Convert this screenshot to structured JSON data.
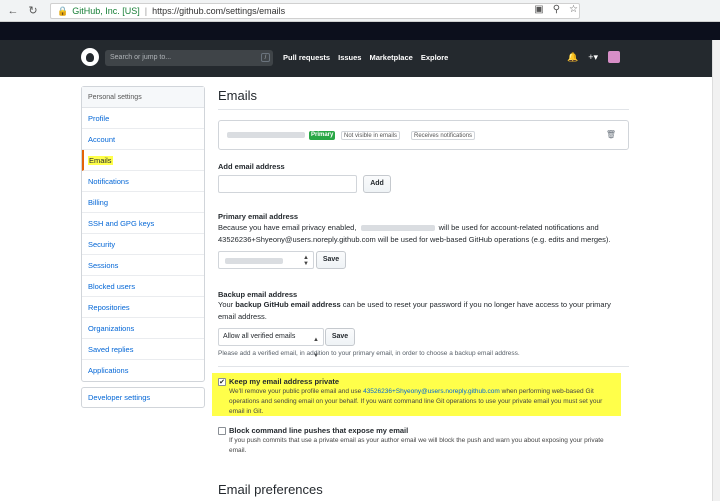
{
  "browser": {
    "site_identity": "GitHub, Inc. [US]",
    "url": "https://github.com/settings/emails"
  },
  "header": {
    "search_placeholder": "Search or jump to...",
    "search_key": "/",
    "nav": [
      "Pull requests",
      "Issues",
      "Marketplace",
      "Explore"
    ]
  },
  "sidebar": {
    "heading": "Personal settings",
    "items": [
      "Profile",
      "Account",
      "Emails",
      "Notifications",
      "Billing",
      "SSH and GPG keys",
      "Security",
      "Sessions",
      "Blocked users",
      "Repositories",
      "Organizations",
      "Saved replies",
      "Applications"
    ],
    "active": "Emails",
    "developer_settings": "Developer settings"
  },
  "main": {
    "title": "Emails",
    "primary_badge": "Primary",
    "visibility_badge": "Not visible in emails",
    "notif_badge": "Receives notifications",
    "add_label": "Add email address",
    "add_button": "Add",
    "primary_label": "Primary email address",
    "primary_text_1": "Because you have email privacy enabled,",
    "primary_text_2": "will be used for account-related notifications and",
    "primary_text_3": "43526236+Shyeony@users.noreply.github.com will be used for web-based GitHub operations (e.g. edits and merges).",
    "save": "Save",
    "backup_label": "Backup email address",
    "backup_text_1a": "Your ",
    "backup_text_1b": "backup GitHub email address",
    "backup_text_1c": " can be used to reset your password if you no longer have access to your primary",
    "backup_text_2": "email address.",
    "backup_select": "Allow all verified emails",
    "backup_note": "Please add a verified email, in addition to your primary email, in order to choose a backup email address.",
    "private_label": "Keep my email address private",
    "private_text_1a": "We'll remove your public profile email and use ",
    "private_text_1b": "43526236+Shyeony@users.noreply.github.com",
    "private_text_1c": " when performing web-based Git",
    "private_text_2": "operations and sending email on your behalf. If you want command line Git operations to use your private email you must set your",
    "private_text_3": "email in Git.",
    "block_label": "Block command line pushes that expose my email",
    "block_text_1": "If you push commits that use a private email as your author email we will block the push and warn you about exposing your private",
    "block_text_2": "email.",
    "preferences_title": "Email preferences"
  }
}
